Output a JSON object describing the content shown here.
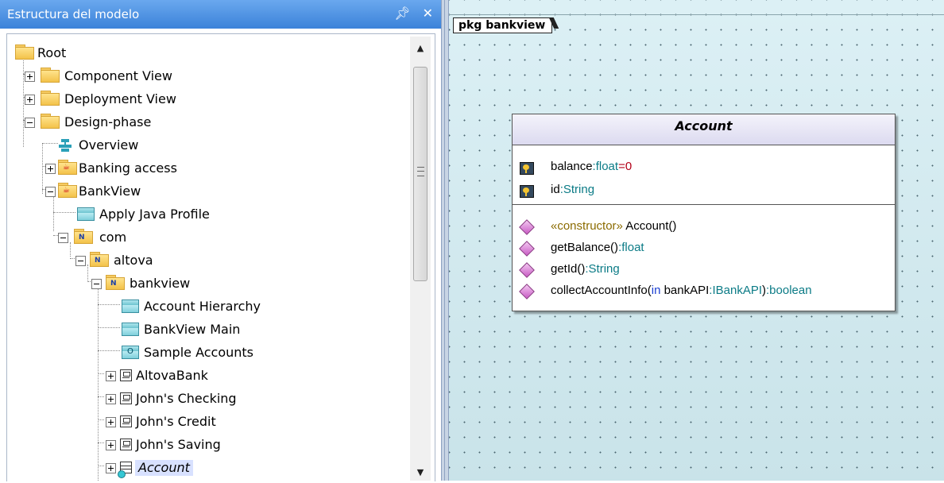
{
  "left_panel": {
    "title": "Estructura del modelo",
    "pin_glyph": "#",
    "close_glyph": "✕",
    "tree": [
      {
        "label": "Root"
      },
      {
        "label": "Component View"
      },
      {
        "label": "Deployment View"
      },
      {
        "label": "Design-phase"
      },
      {
        "label": "Overview"
      },
      {
        "label": "Banking access"
      },
      {
        "label": "BankView"
      },
      {
        "label": "Apply Java Profile"
      },
      {
        "label": "com"
      },
      {
        "label": "altova"
      },
      {
        "label": "bankview"
      },
      {
        "label": "Account Hierarchy"
      },
      {
        "label": "BankView Main"
      },
      {
        "label": "Sample Accounts"
      },
      {
        "label": "AltovaBank"
      },
      {
        "label": "John's Checking"
      },
      {
        "label": "John's Credit"
      },
      {
        "label": "John's Saving"
      },
      {
        "label": "Account"
      }
    ],
    "scroll_up_glyph": "▲",
    "scroll_down_glyph": "▼"
  },
  "diagram": {
    "package_tab": "pkg bankview",
    "class": {
      "name": "Account",
      "attributes": [
        {
          "name": "balance",
          "sep": ":",
          "type": "float",
          "eq": "=",
          "default": "0"
        },
        {
          "name": "id",
          "sep": ":",
          "type": "String"
        }
      ],
      "operations": {
        "ctor_stereotype": "«constructor»",
        "ctor_name": " Account()",
        "get_balance": "getBalance()",
        "get_balance_type": ":float",
        "get_id": "getId()",
        "get_id_type": ":String",
        "collect_name": "collectAccountInfo(",
        "collect_in": "in",
        "collect_param": " bankAPI",
        "collect_param_type": ":IBankAPI",
        "collect_close": ")",
        "collect_ret": ":boolean"
      }
    }
  }
}
